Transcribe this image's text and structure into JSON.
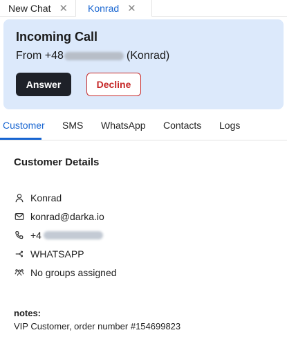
{
  "window_tabs": [
    {
      "label": "New Chat",
      "close_icon": "close-icon"
    },
    {
      "label": "Konrad",
      "close_icon": "close-icon",
      "active": true
    }
  ],
  "call": {
    "title": "Incoming Call",
    "from_prefix": "From +48",
    "from_suffix": "(Konrad)",
    "answer_label": "Answer",
    "decline_label": "Decline"
  },
  "nav_tabs": [
    {
      "label": "Customer",
      "active": true
    },
    {
      "label": "SMS"
    },
    {
      "label": "WhatsApp"
    },
    {
      "label": "Contacts"
    },
    {
      "label": "Logs"
    }
  ],
  "customer": {
    "heading": "Customer Details",
    "name": "Konrad",
    "email": "konrad@darka.io",
    "phone_prefix": "+4",
    "channel": "WHATSAPP",
    "groups": "No groups assigned"
  },
  "notes": {
    "label": "notes:",
    "text": "VIP Customer, order number #154699823"
  },
  "colors": {
    "accent": "#1765d1",
    "call_card_bg": "#dce9fb",
    "answer_bg": "#1e2128",
    "decline": "#c62828"
  }
}
